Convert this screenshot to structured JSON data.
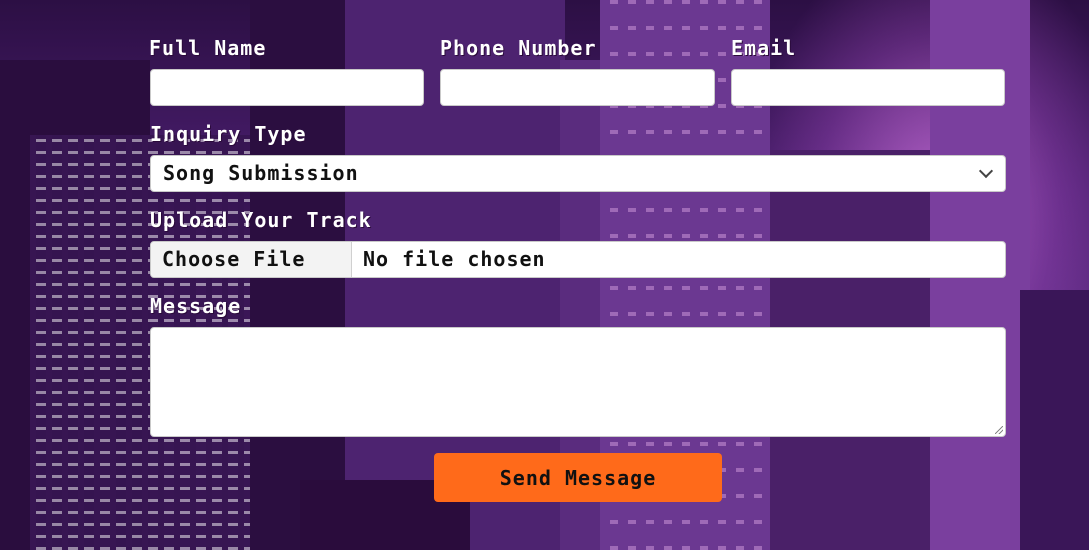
{
  "form": {
    "full_name": {
      "label": "Full Name",
      "value": "",
      "placeholder": ""
    },
    "phone": {
      "label": "Phone Number",
      "value": "",
      "placeholder": ""
    },
    "email": {
      "label": "Email",
      "value": "",
      "placeholder": ""
    },
    "inquiry_type": {
      "label": "Inquiry Type",
      "selected": "Song Submission"
    },
    "upload": {
      "label": "Upload Your Track",
      "button_label": "Choose File",
      "status": "No file chosen"
    },
    "message": {
      "label": "Message",
      "value": ""
    },
    "submit_label": "Send Message"
  },
  "colors": {
    "button_bg": "#ff6a1a",
    "label_text": "#ffffff",
    "background": "#3a1858"
  },
  "icons": {
    "select_arrow": "chevron-down-icon",
    "textarea_resize": "resize-handle-icon"
  }
}
